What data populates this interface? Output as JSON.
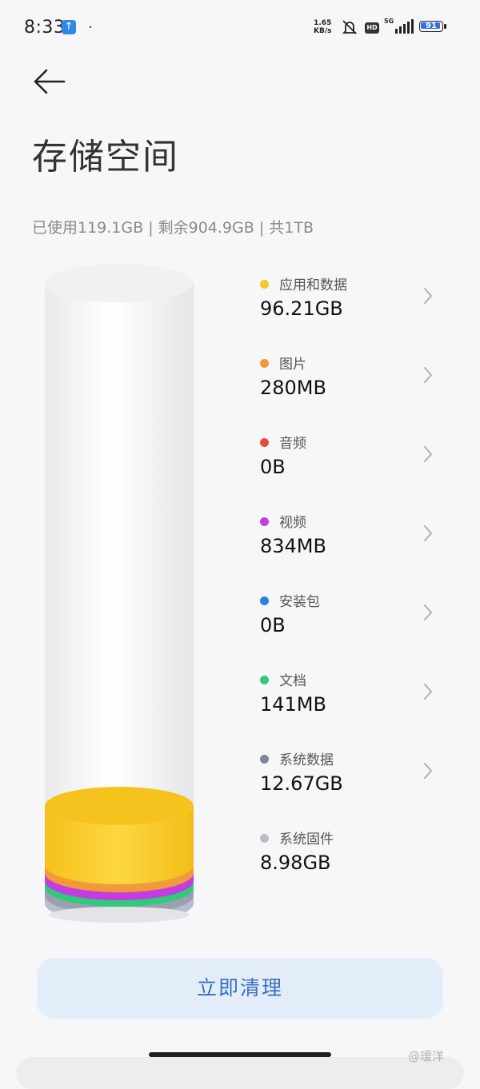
{
  "status_bar": {
    "time": "8:33",
    "upload_icon": "arrow-up",
    "speed_value": "1.65",
    "speed_unit": "KB/s",
    "hd": "HD",
    "network": "5G",
    "battery": "91"
  },
  "header": {
    "back_icon": "arrow-left",
    "title": "存储空间"
  },
  "summary": "已使用119.1GB | 剩余904.9GB | 共1TB",
  "categories": [
    {
      "label": "应用和数据",
      "value": "96.21GB",
      "color": "#f7c72a"
    },
    {
      "label": "图片",
      "value": "280MB",
      "color": "#f09a3a"
    },
    {
      "label": "音频",
      "value": "0B",
      "color": "#e84a42"
    },
    {
      "label": "视频",
      "value": "834MB",
      "color": "#c53de0"
    },
    {
      "label": "安装包",
      "value": "0B",
      "color": "#2e7fe0"
    },
    {
      "label": "文档",
      "value": "141MB",
      "color": "#2ecb7c"
    },
    {
      "label": "系统数据",
      "value": "12.67GB",
      "color": "#7e8596"
    },
    {
      "label": "系统固件",
      "value": "8.98GB",
      "color": "#b8bdcc"
    }
  ],
  "clean_button": "立即清理",
  "watermark": "@瑷洋"
}
